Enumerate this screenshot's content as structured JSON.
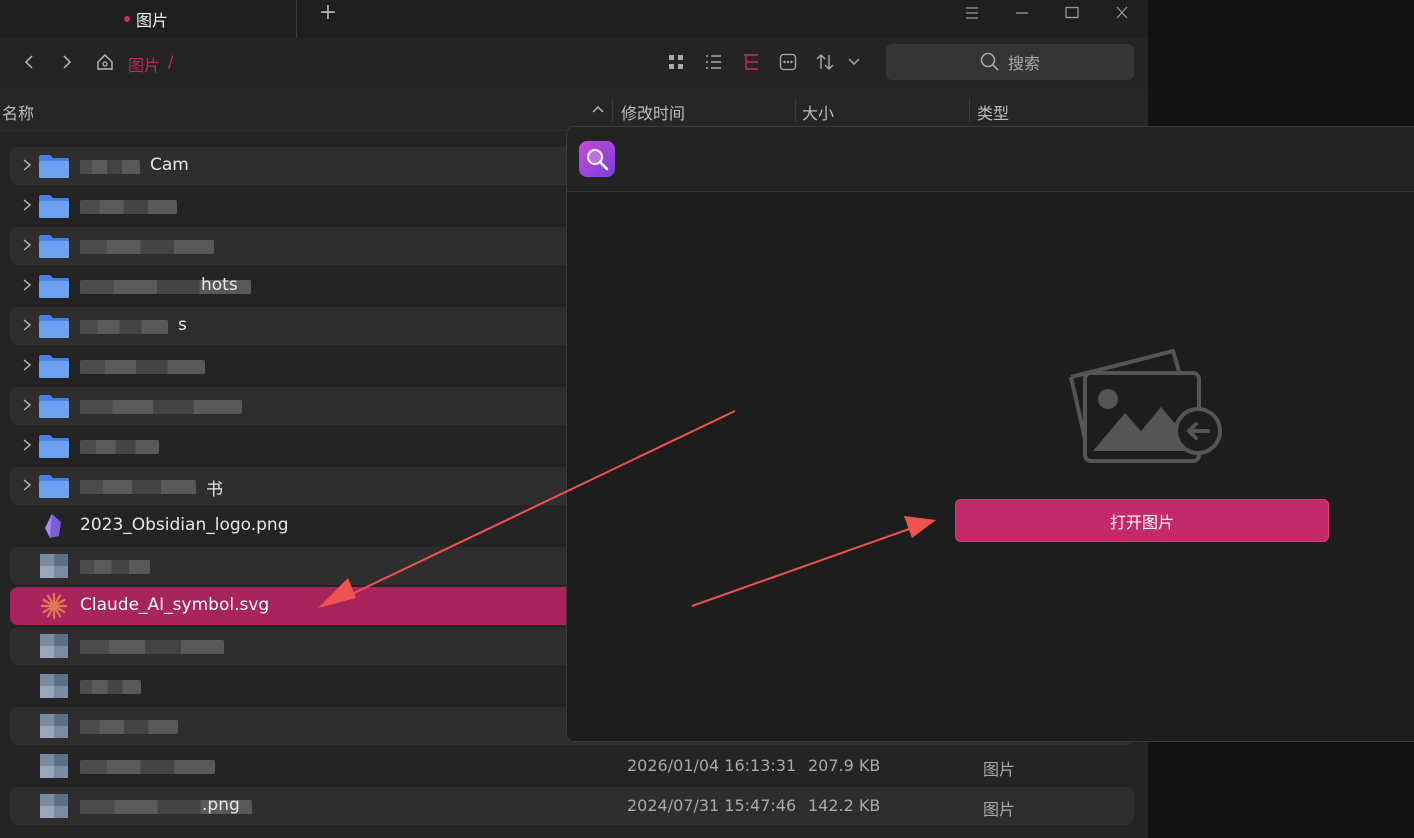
{
  "tab": {
    "label": "图片"
  },
  "breadcrumb": {
    "location": "图片",
    "separator": "/"
  },
  "search": {
    "placeholder": "搜索"
  },
  "columns": {
    "name": "名称",
    "modified": "修改时间",
    "size": "大小",
    "type": "类型"
  },
  "rows": [
    {
      "name": "Cam",
      "kind": "folder",
      "style": "alt"
    },
    {
      "name": "",
      "kind": "folder",
      "style": ""
    },
    {
      "name": "",
      "kind": "folder",
      "style": "alt"
    },
    {
      "name": "hots",
      "kind": "folder",
      "style": ""
    },
    {
      "name": "s",
      "kind": "folder",
      "style": "alt"
    },
    {
      "name": "",
      "kind": "folder",
      "style": ""
    },
    {
      "name": "",
      "kind": "folder",
      "style": "alt"
    },
    {
      "name": "",
      "kind": "folder",
      "style": ""
    },
    {
      "name": "书",
      "kind": "folder",
      "style": "alt"
    },
    {
      "name": "2023_Obsidian_logo.png",
      "kind": "obsidian",
      "style": ""
    },
    {
      "name": "",
      "kind": "image",
      "style": "alt"
    },
    {
      "name": "Claude_AI_symbol.svg",
      "kind": "claude",
      "style": "sel"
    },
    {
      "name": "",
      "kind": "image",
      "style": "alt"
    },
    {
      "name": "",
      "kind": "image",
      "style": ""
    },
    {
      "name": "",
      "kind": "image",
      "style": "alt"
    },
    {
      "name": "",
      "kind": "image",
      "style": "",
      "date": "2026/01/04 16:13:31",
      "size": "207.9 KB",
      "type": "图片"
    },
    {
      "name": ".png",
      "kind": "image",
      "style": "alt",
      "date": "2024/07/31 15:47:46",
      "size": "142.2 KB",
      "type": "图片"
    }
  ],
  "viewer": {
    "open_button": "打开图片"
  },
  "colors": {
    "accent": "#c4296a",
    "selection": "#a8245a",
    "arrow": "#ef5350"
  }
}
